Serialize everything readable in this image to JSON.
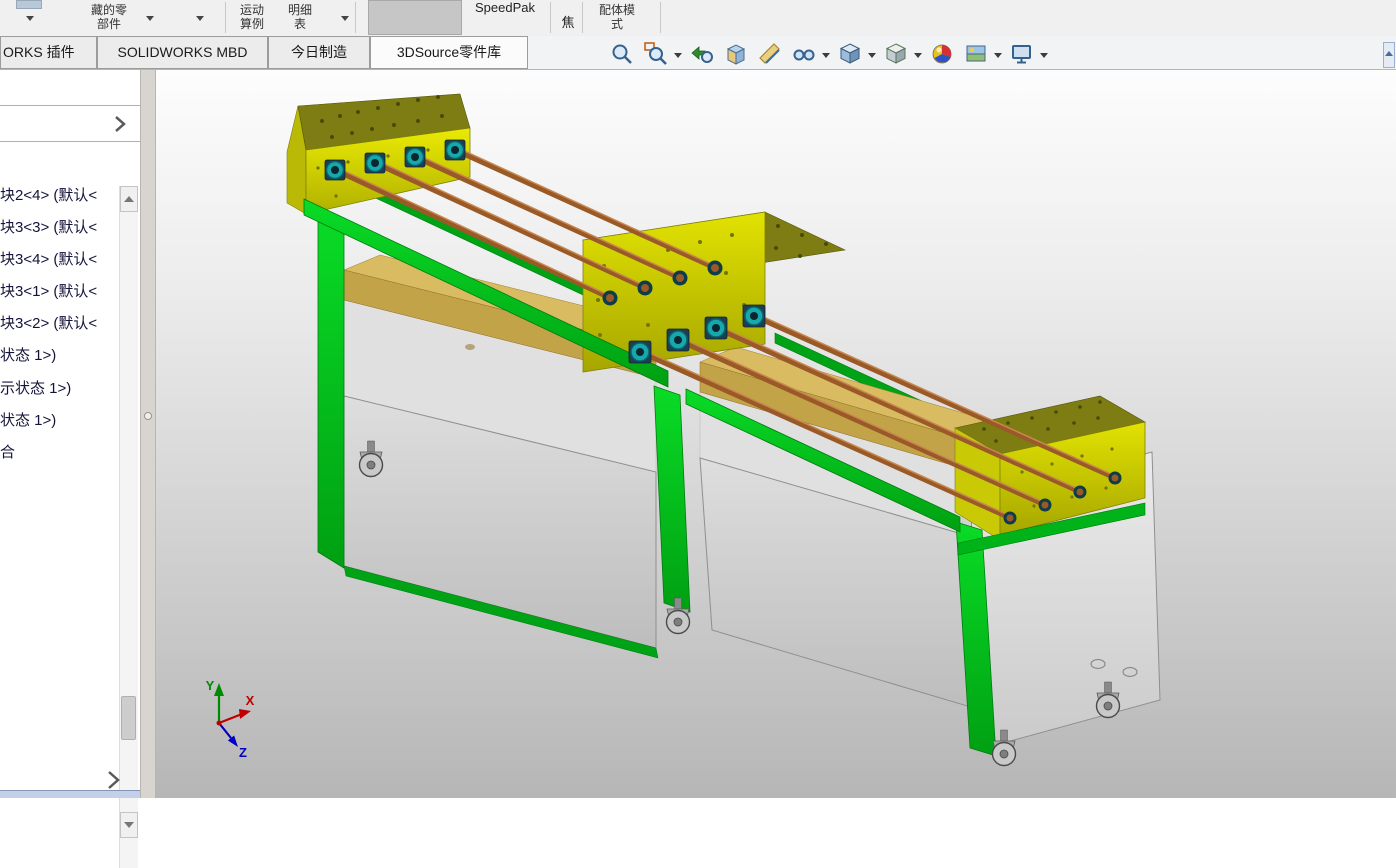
{
  "command_bar": {
    "hidden_components": [
      "藏的零",
      "部件"
    ],
    "motion_study": [
      "运动",
      "算例"
    ],
    "bom_table": [
      "明细",
      "表"
    ],
    "speedpak": "SpeedPak",
    "focus": "焦",
    "mate_mode": [
      "配体模",
      "式"
    ]
  },
  "tab_bar": {
    "addins": "ORKS 插件",
    "mbd": "SOLIDWORKS MBD",
    "today_mfg": "今日制造",
    "source3d": "3DSource零件库"
  },
  "feature_tree": {
    "items": [
      "块2<4> (默认<",
      "块3<3> (默认<",
      "块3<4> (默认<",
      "块3<1> (默认<",
      "块3<2> (默认<",
      "状态 1>)",
      "示状态 1>)",
      "状态 1>)",
      "合"
    ]
  },
  "viewport": {
    "triad": {
      "x": "X",
      "y": "Y",
      "z": "Z"
    }
  },
  "colors": {
    "frame_green": "#00c818",
    "housing_yellow": "#d2d200",
    "housing_top_olive": "#7d7d14",
    "rod_brown": "#9a5a28",
    "panel_gray": "#d2d2d2",
    "shelf_tan": "#c3a348",
    "bearing_teal": "#16a8ac",
    "triad_x": "#c00000",
    "triad_y": "#008a00",
    "triad_z": "#0000c0"
  }
}
